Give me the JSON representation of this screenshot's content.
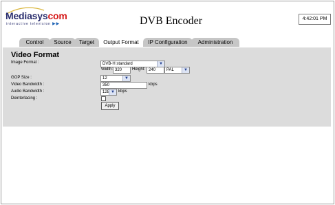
{
  "logo": {
    "brand_main": "Mediasys",
    "brand_accent": "com",
    "tagline": "interactive television",
    "tagline_arrows": "▶▶"
  },
  "header": {
    "title": "DVB Encoder",
    "clock": "4:42:01 PM"
  },
  "tabs": [
    {
      "label": "Control",
      "active": false
    },
    {
      "label": "Source",
      "active": false
    },
    {
      "label": "Target",
      "active": false
    },
    {
      "label": "Output Format",
      "active": true
    },
    {
      "label": "IP Configuration",
      "active": false
    },
    {
      "label": "Administration",
      "active": false
    }
  ],
  "form": {
    "section_title": "Video Format",
    "image_format": {
      "label": "Image Format :",
      "value": "DVB-H standard",
      "width_label": "Width:",
      "width_value": "320",
      "height_label": "Height:",
      "height_value": "240",
      "standard_value": "PAL"
    },
    "gop_size": {
      "label": "GOP Size :",
      "value": "12"
    },
    "video_bandwidth": {
      "label": "Video Bandwidth :",
      "value": "350",
      "unit": "kbps"
    },
    "audio_bandwidth": {
      "label": "Audio Bandwidth :",
      "value": "128",
      "unit": "kbps"
    },
    "deinterlacing": {
      "label": "Deinterlacing :",
      "checked": false
    },
    "apply_label": "Apply"
  },
  "colors": {
    "panel_bg": "#dcdcdc",
    "tab_inactive": "#c6c6c6",
    "brand_navy": "#2a2e6e",
    "brand_red": "#d61c1c"
  },
  "icons": {
    "dropdown": "chevron-down-icon",
    "tagline_arrows": "double-play-arrow-icon"
  }
}
